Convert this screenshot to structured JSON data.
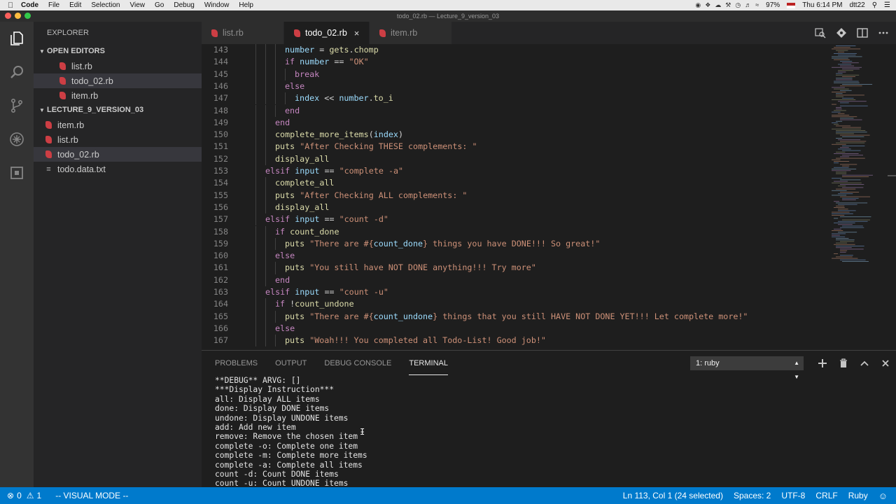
{
  "menubar": {
    "app_name": "Code",
    "items": [
      "File",
      "Edit",
      "Selection",
      "View",
      "Go",
      "Debug",
      "Window",
      "Help"
    ],
    "battery": "97%",
    "clock": "Thu 6:14 PM",
    "user": "dtt22"
  },
  "window": {
    "title": "todo_02.rb — Lecture_9_version_03"
  },
  "sidebar": {
    "title": "EXPLORER",
    "open_editors_label": "OPEN EDITORS",
    "open_editors": [
      "list.rb",
      "todo_02.rb",
      "item.rb"
    ],
    "project_label": "LECTURE_9_VERSION_03",
    "project_files": [
      "item.rb",
      "list.rb",
      "todo_02.rb",
      "todo.data.txt"
    ]
  },
  "tabs": [
    {
      "label": "list.rb"
    },
    {
      "label": "todo_02.rb",
      "close": "×"
    },
    {
      "label": "item.rb"
    }
  ],
  "editor": {
    "lines": [
      {
        "n": "143",
        "indent": 4,
        "tokens": [
          [
            "id",
            "number"
          ],
          [
            "plain",
            " = "
          ],
          [
            "fn",
            "gets"
          ],
          [
            "plain",
            "."
          ],
          [
            "fn",
            "chomp"
          ]
        ]
      },
      {
        "n": "144",
        "indent": 4,
        "tokens": [
          [
            "kw",
            "if "
          ],
          [
            "id",
            "number"
          ],
          [
            "plain",
            " == "
          ],
          [
            "str",
            "\"OK\""
          ]
        ]
      },
      {
        "n": "145",
        "indent": 5,
        "tokens": [
          [
            "kw",
            "break"
          ]
        ]
      },
      {
        "n": "146",
        "indent": 4,
        "tokens": [
          [
            "kw",
            "else"
          ]
        ]
      },
      {
        "n": "147",
        "indent": 5,
        "tokens": [
          [
            "id",
            "index"
          ],
          [
            "plain",
            " << "
          ],
          [
            "id",
            "number"
          ],
          [
            "plain",
            "."
          ],
          [
            "fn",
            "to_i"
          ]
        ]
      },
      {
        "n": "148",
        "indent": 4,
        "tokens": [
          [
            "kw",
            "end"
          ]
        ]
      },
      {
        "n": "149",
        "indent": 3,
        "tokens": [
          [
            "kw",
            "end"
          ]
        ]
      },
      {
        "n": "150",
        "indent": 3,
        "tokens": [
          [
            "fn",
            "complete_more_items"
          ],
          [
            "plain",
            "("
          ],
          [
            "id",
            "index"
          ],
          [
            "plain",
            ")"
          ]
        ]
      },
      {
        "n": "151",
        "indent": 3,
        "tokens": [
          [
            "fn",
            "puts "
          ],
          [
            "str",
            "\"After Checking THESE complements: \""
          ]
        ]
      },
      {
        "n": "152",
        "indent": 3,
        "tokens": [
          [
            "fn",
            "display_all"
          ]
        ]
      },
      {
        "n": "153",
        "indent": 2,
        "tokens": [
          [
            "kw",
            "elsif "
          ],
          [
            "id",
            "input"
          ],
          [
            "plain",
            " == "
          ],
          [
            "str",
            "\"complete -a\""
          ]
        ]
      },
      {
        "n": "154",
        "indent": 3,
        "tokens": [
          [
            "fn",
            "complete_all"
          ]
        ]
      },
      {
        "n": "155",
        "indent": 3,
        "tokens": [
          [
            "fn",
            "puts "
          ],
          [
            "str",
            "\"After Checking ALL complements: \""
          ]
        ]
      },
      {
        "n": "156",
        "indent": 3,
        "tokens": [
          [
            "fn",
            "display_all"
          ]
        ]
      },
      {
        "n": "157",
        "indent": 2,
        "tokens": [
          [
            "kw",
            "elsif "
          ],
          [
            "id",
            "input"
          ],
          [
            "plain",
            " == "
          ],
          [
            "str",
            "\"count -d\""
          ]
        ]
      },
      {
        "n": "158",
        "indent": 3,
        "tokens": [
          [
            "kw",
            "if "
          ],
          [
            "fn",
            "count_done"
          ]
        ]
      },
      {
        "n": "159",
        "indent": 4,
        "tokens": [
          [
            "fn",
            "puts "
          ],
          [
            "str",
            "\"There are #{"
          ],
          [
            "id",
            "count_done"
          ],
          [
            "str",
            "} things you have DONE!!! So great!\""
          ]
        ]
      },
      {
        "n": "160",
        "indent": 3,
        "tokens": [
          [
            "kw",
            "else"
          ]
        ]
      },
      {
        "n": "161",
        "indent": 4,
        "tokens": [
          [
            "fn",
            "puts "
          ],
          [
            "str",
            "\"You still have NOT DONE anything!!! Try more\""
          ]
        ]
      },
      {
        "n": "162",
        "indent": 3,
        "tokens": [
          [
            "kw",
            "end"
          ]
        ]
      },
      {
        "n": "163",
        "indent": 2,
        "tokens": [
          [
            "kw",
            "elsif "
          ],
          [
            "id",
            "input"
          ],
          [
            "plain",
            " == "
          ],
          [
            "str",
            "\"count -u\""
          ]
        ]
      },
      {
        "n": "164",
        "indent": 3,
        "tokens": [
          [
            "kw",
            "if "
          ],
          [
            "plain",
            "!"
          ],
          [
            "fn",
            "count_undone"
          ]
        ]
      },
      {
        "n": "165",
        "indent": 4,
        "tokens": [
          [
            "fn",
            "puts "
          ],
          [
            "str",
            "\"There are #{"
          ],
          [
            "id",
            "count_undone"
          ],
          [
            "str",
            "} things that you still HAVE NOT DONE YET!!! Let complete more!\""
          ]
        ]
      },
      {
        "n": "166",
        "indent": 3,
        "tokens": [
          [
            "kw",
            "else"
          ]
        ]
      },
      {
        "n": "167",
        "indent": 4,
        "tokens": [
          [
            "fn",
            "puts "
          ],
          [
            "str",
            "\"Woah!!! You completed all Todo-List! Good job!\""
          ]
        ]
      }
    ]
  },
  "panel": {
    "tabs": [
      "PROBLEMS",
      "OUTPUT",
      "DEBUG CONSOLE",
      "TERMINAL"
    ],
    "active_tab": "TERMINAL",
    "terminal_select": "1: ruby",
    "terminal_lines": [
      "**DEBUG** ARVG: []",
      "***Display Instruction***",
      "all: Display ALL items",
      "done: Display DONE items",
      "undone: Display UNDONE items",
      "add: Add new item",
      "remove: Remove the chosen item",
      "complete -o: Complete one item",
      "complete -m: Complete more items",
      "complete -a: Complete all items",
      "count -d: Count DONE items",
      "count -u: Count UNDONE items"
    ]
  },
  "statusbar": {
    "errors": "0",
    "warnings": "1",
    "mode": "-- VISUAL MODE --",
    "position": "Ln 113, Col 1 (24 selected)",
    "spaces": "Spaces: 2",
    "encoding": "UTF-8",
    "eol": "CRLF",
    "language": "Ruby"
  },
  "colors": {
    "accent": "#007acc",
    "ruby_icon": "#cc3e44"
  }
}
